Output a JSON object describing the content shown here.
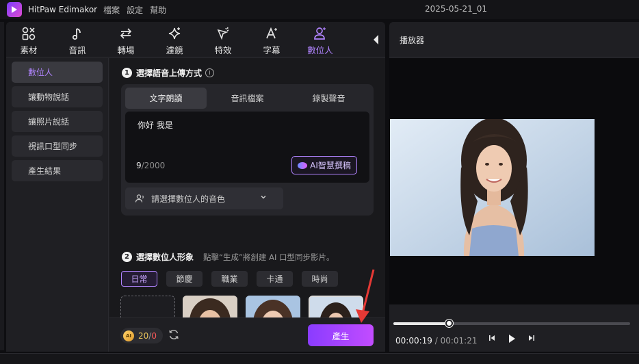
{
  "app": {
    "title": "HitPaw Edimakor",
    "menu": [
      "檔案",
      "設定",
      "幫助"
    ],
    "project_title": "2025-05-21_01"
  },
  "toolbar": {
    "tools": [
      {
        "label": "素材",
        "icon": "assets-icon"
      },
      {
        "label": "音訊",
        "icon": "music-note-icon"
      },
      {
        "label": "轉場",
        "icon": "transition-arrows-icon"
      },
      {
        "label": "濾鏡",
        "icon": "sparkle-icon"
      },
      {
        "label": "特效",
        "icon": "effects-wand-icon"
      },
      {
        "label": "字幕",
        "icon": "text-a-icon"
      },
      {
        "label": "數位人",
        "icon": "digital-human-icon"
      }
    ],
    "active_index": 6
  },
  "sidebar": {
    "items": [
      "數位人",
      "讓動物說話",
      "讓照片說話",
      "視訊口型同步",
      "產生結果"
    ],
    "active_index": 0
  },
  "step1": {
    "number": "1",
    "title": "選擇語音上傳方式",
    "tabs": [
      "文字朗讀",
      "音訊檔案",
      "錄製聲音"
    ],
    "active_tab": 0,
    "text_value": "你好 我是",
    "char_count": "9",
    "char_limit": "/2000",
    "ai_button": "AI智慧撰稿",
    "voice_placeholder": "請選擇數位人的音色"
  },
  "step2": {
    "number": "2",
    "title": "選擇數位人形象",
    "hint": "點擊“生成”將創建 AI 口型同步影片。",
    "categories": [
      "日常",
      "節慶",
      "職業",
      "卡通",
      "時尚"
    ],
    "active_category": 0
  },
  "bottom": {
    "credit_used": "20",
    "credit_sep": "/",
    "credit_left": "0",
    "coin_label": "AI",
    "generate_button": "產生"
  },
  "player": {
    "title": "播放器",
    "current_time": "00:00:19",
    "time_sep": " / ",
    "total_time": "00:01:21",
    "progress": 0.235
  },
  "colors": {
    "accent": "#b184ff",
    "generate_gradient": [
      "#8a3cff",
      "#c24cff"
    ],
    "annotation": "#e53935"
  }
}
